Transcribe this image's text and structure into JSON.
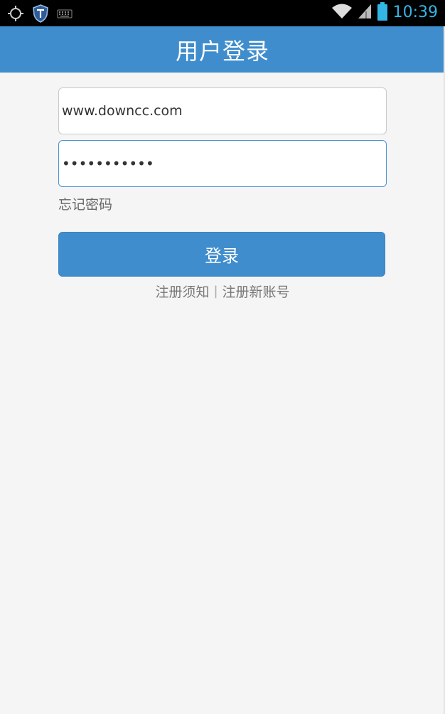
{
  "status_bar": {
    "time": "10:39",
    "icons": [
      "gps-icon",
      "shield-icon",
      "keyboard-icon",
      "wifi-icon",
      "signal-icon",
      "battery-icon"
    ],
    "time_color": "#33b5e5"
  },
  "app_bar": {
    "title": "用户登录",
    "background": "#3f8dcd"
  },
  "form": {
    "username_value": "www.downcc.com",
    "password_value": "•••••••••••",
    "forgot_password": "忘记密码"
  },
  "actions": {
    "login_label": "登录",
    "register_notice": "注册须知",
    "separator": "|",
    "register_new": "注册新账号"
  }
}
